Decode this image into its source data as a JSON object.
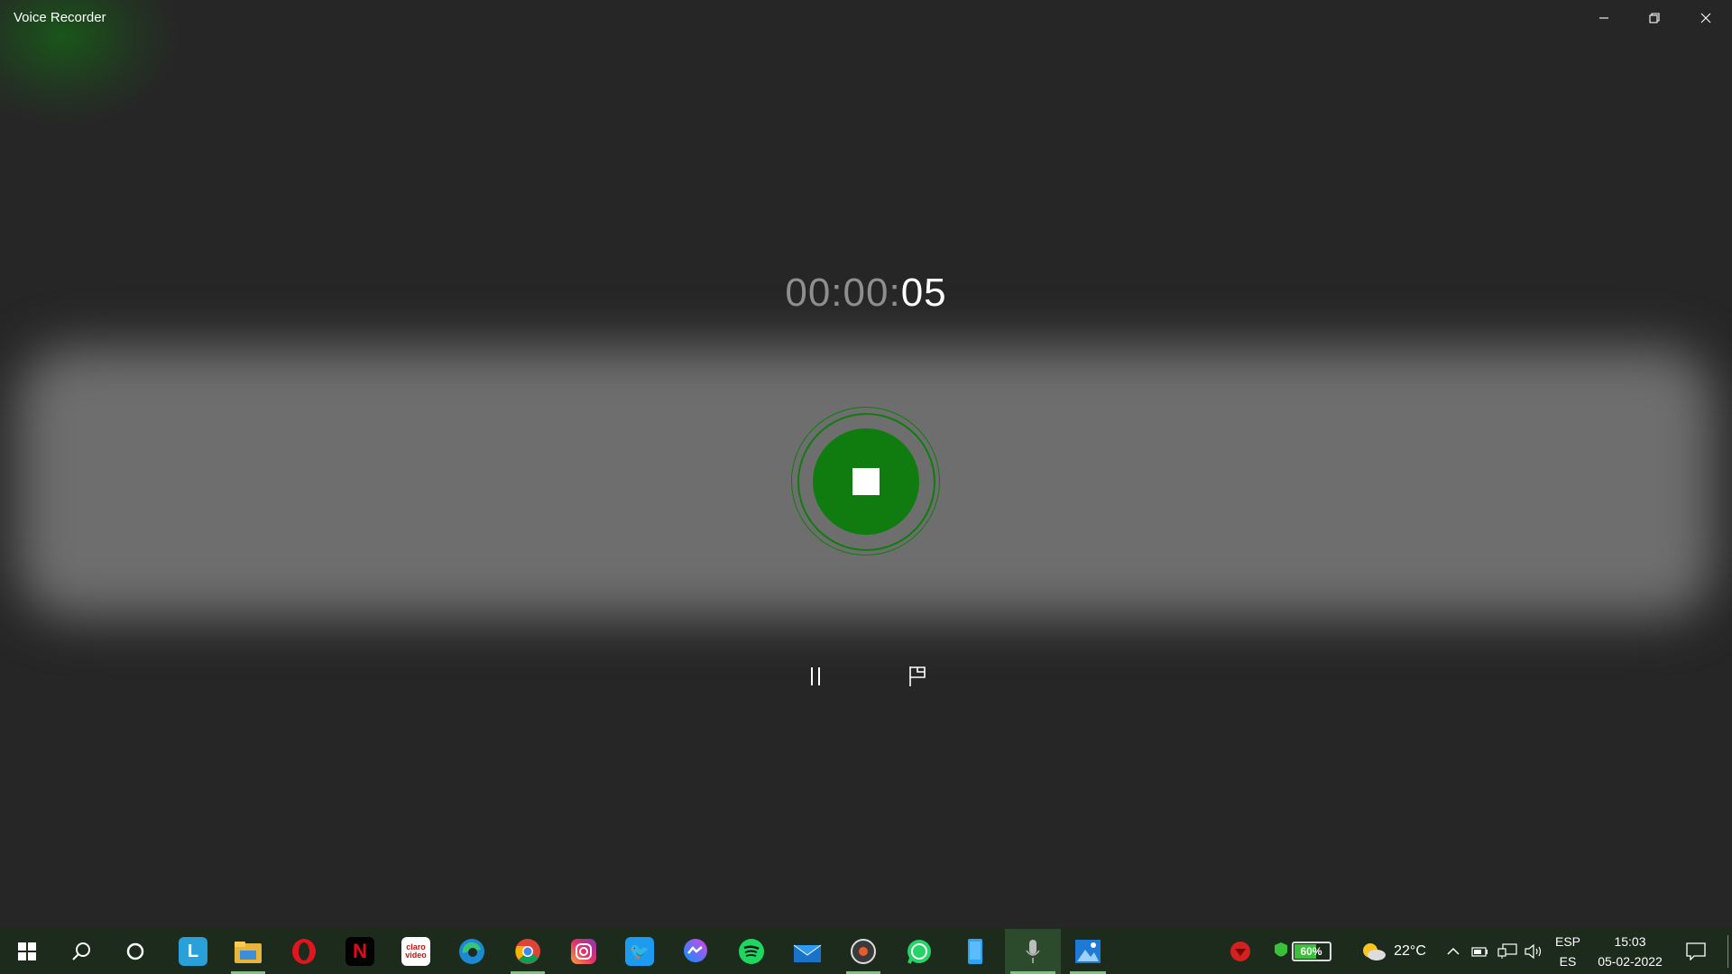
{
  "window": {
    "title": "Voice Recorder",
    "accent_color": "#107c10",
    "controls": [
      "minimize-icon",
      "restore-icon",
      "close-icon"
    ]
  },
  "recorder": {
    "timer_hidden_part": "00:00:",
    "timer_seconds": "05",
    "stop_icon": "stop-icon",
    "pause_icon": "pause-icon",
    "marker_icon": "flag-icon"
  },
  "taskbar": {
    "apps": [
      "start",
      "search",
      "cortana",
      "L app",
      "file-explorer",
      "opera",
      "netflix",
      "claro-video",
      "edge",
      "chrome",
      "instagram",
      "twitter",
      "messenger",
      "spotify",
      "mail",
      "groove",
      "whatsapp",
      "phone",
      "voice-recorder",
      "photos"
    ],
    "battery_percent": "60%",
    "temperature": "22°C",
    "language_top": "ESP",
    "language_bottom": "ES",
    "time": "15:03",
    "date": "05-02-2022"
  }
}
